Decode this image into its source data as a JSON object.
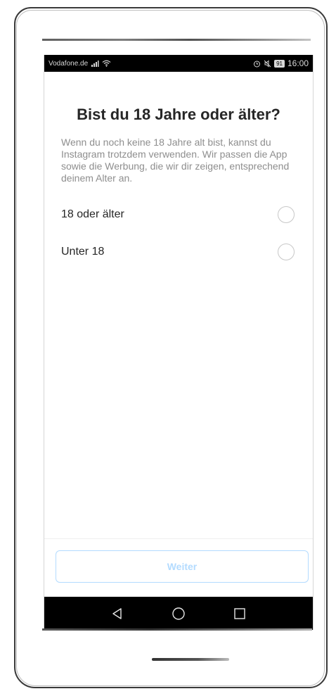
{
  "status_bar": {
    "carrier": "Vodafone.de",
    "signal_icon": "signal-bars-icon",
    "wifi_icon": "wifi-icon",
    "alarm_icon": "alarm-icon",
    "mute_icon": "mute-icon",
    "battery_level": "91",
    "time": "16:00"
  },
  "screen": {
    "title": "Bist du 18 Jahre oder älter?",
    "description": "Wenn du noch keine 18 Jahre alt bist, kannst du Instagram trotzdem verwenden. Wir passen die App sowie die Werbung, die wir dir zeigen, entsprechend deinem Alter an.",
    "options": [
      {
        "label": "18 oder älter",
        "selected": false
      },
      {
        "label": "Unter 18",
        "selected": false
      }
    ],
    "continue_label": "Weiter"
  },
  "navigation": {
    "back_icon": "back-triangle-icon",
    "home_icon": "home-circle-icon",
    "recents_icon": "recents-square-icon"
  },
  "colors": {
    "title": "#262626",
    "description": "#8e8e8e",
    "button_disabled": "#b3dbff",
    "status_bar_bg": "#000000"
  }
}
